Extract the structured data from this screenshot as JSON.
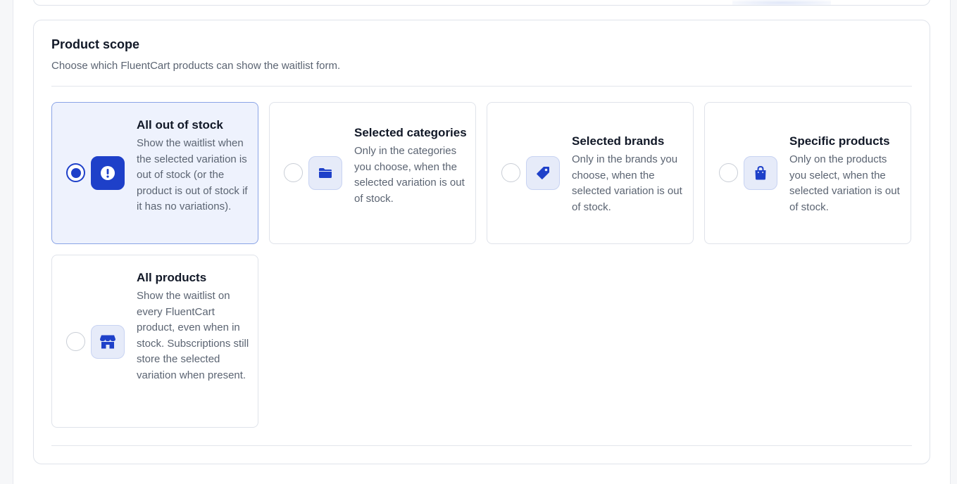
{
  "section": {
    "title": "Product scope",
    "description": "Choose which FluentCart products can show the waitlist form."
  },
  "options": [
    {
      "title": "All out of stock",
      "description": "Show the waitlist when the selected variation is out of stock (or the product is out of stock if it has no variations).",
      "icon": "alert-circle-icon",
      "selected": true
    },
    {
      "title": "Selected categories",
      "description": "Only in the categories you choose, when the selected variation is out of stock.",
      "icon": "folder-icon",
      "selected": false
    },
    {
      "title": "Selected brands",
      "description": "Only in the brands you choose, when the selected variation is out of stock.",
      "icon": "tag-icon",
      "selected": false
    },
    {
      "title": "Specific products",
      "description": "Only on the products you select, when the selected variation is out of stock.",
      "icon": "shopping-bag-icon",
      "selected": false
    },
    {
      "title": "All products",
      "description": "Show the waitlist on every FluentCart product, even when in stock. Subscriptions still store the selected variation when present.",
      "icon": "store-icon",
      "selected": false
    }
  ],
  "colors": {
    "accent": "#1e40c9",
    "selected_bg": "#eef2fd",
    "selected_border": "#8aa4e6"
  }
}
